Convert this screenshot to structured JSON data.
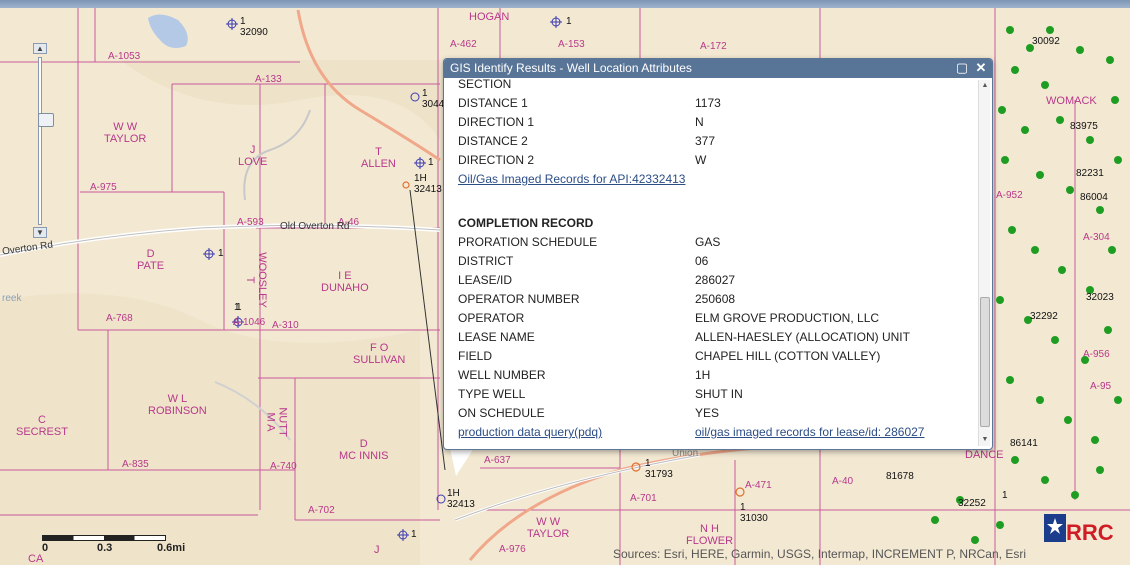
{
  "map": {
    "survey_names": [
      {
        "text": "HOGAN"
      },
      {
        "text": "W W\nTAYLOR"
      },
      {
        "text": "J\nLOVE"
      },
      {
        "text": "T\nALLEN"
      },
      {
        "text": "D\nPATE"
      },
      {
        "text": "WOOSLEY\nT"
      },
      {
        "text": "I E\nDUNAHO"
      },
      {
        "text": "F O\nSULLIVAN"
      },
      {
        "text": "W L\nROBINSON"
      },
      {
        "text": "NUTT\nM A"
      },
      {
        "text": "C\nSECREST"
      },
      {
        "text": "D\nMC INNIS"
      },
      {
        "text": "W W\nTAYLOR"
      },
      {
        "text": "N H\nFLOWER"
      },
      {
        "text": "WOMACK"
      },
      {
        "text": "DANCE"
      },
      {
        "text": "J"
      },
      {
        "text": "CA"
      }
    ],
    "abstract_labels": [
      "A-462",
      "A-153",
      "A-172",
      "A-1053",
      "A-133",
      "A-975",
      "A-593",
      "A-46",
      "A-768",
      "A-1046",
      "A-310",
      "A-835",
      "A-740",
      "A-702",
      "A-637",
      "A-701",
      "A-471",
      "A-40",
      "A-976",
      "A-952",
      "A-304",
      "A-956",
      "A-95"
    ],
    "road_labels": [
      "Old Overton Rd",
      "Overton Rd",
      "reek",
      "Union"
    ],
    "well_labels": [
      "1\n32090",
      "1",
      "1\n3044",
      "1",
      "1H\n32413",
      "1",
      "1",
      "1",
      "1H\n32413",
      "1\n31793",
      "1\n31030",
      "1",
      "30092",
      "83975",
      "82231",
      "86004",
      "32023",
      "32292",
      "86141",
      "81678",
      "32252",
      "1"
    ],
    "logo_text": "RRC",
    "attribution": "Sources: Esri, HERE, Garmin, USGS, Intermap, INCREMENT P, NRCan, Esri",
    "scale": {
      "labels": [
        "0",
        "0.3",
        "0.6mi"
      ]
    }
  },
  "zoom": {
    "plus_icon": "plus-icon",
    "minus_icon": "minus-icon",
    "level": 0.7
  },
  "popup": {
    "title": "GIS Identify Results - Well Location Attributes",
    "maximize_icon": "maximize-icon",
    "close_icon": "close-icon",
    "rows": [
      {
        "key": "SECTION",
        "value": ""
      },
      {
        "key": "DISTANCE 1",
        "value": "1173"
      },
      {
        "key": "DIRECTION 1",
        "value": "N"
      },
      {
        "key": "DISTANCE 2",
        "value": "377"
      },
      {
        "key": "DIRECTION 2",
        "value": "W"
      }
    ],
    "imaged_link": "Oil/Gas Imaged Records for API:42332413",
    "completion_header": "COMPLETION RECORD",
    "completion_rows": [
      {
        "key": "PRORATION SCHEDULE",
        "value": "GAS"
      },
      {
        "key": "DISTRICT",
        "value": "06"
      },
      {
        "key": "LEASE/ID",
        "value": "286027"
      },
      {
        "key": "OPERATOR NUMBER",
        "value": "250608"
      },
      {
        "key": "OPERATOR",
        "value": "ELM GROVE PRODUCTION, LLC"
      },
      {
        "key": "LEASE NAME",
        "value": "ALLEN-HAESLEY (ALLOCATION) UNIT"
      },
      {
        "key": "FIELD",
        "value": "CHAPEL HILL (COTTON VALLEY)"
      },
      {
        "key": "WELL NUMBER",
        "value": "1H"
      },
      {
        "key": "TYPE WELL",
        "value": "SHUT IN"
      },
      {
        "key": "ON SCHEDULE",
        "value": "YES"
      }
    ],
    "pdq_link": "production data query(pdq)",
    "lease_link": "oil/gas imaged records for lease/id: 286027"
  }
}
